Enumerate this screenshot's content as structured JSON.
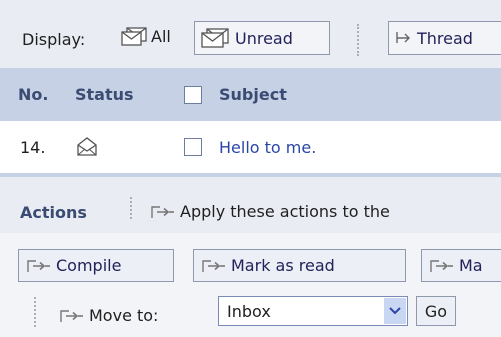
{
  "display": {
    "label": "Display:",
    "all_label": "All",
    "unread_label": "Unread",
    "thread_label": "Thread"
  },
  "table": {
    "columns": {
      "no": "No.",
      "status": "Status",
      "subject": "Subject"
    },
    "rows": [
      {
        "no": "14.",
        "subject": "Hello to me."
      }
    ]
  },
  "actions": {
    "label": "Actions",
    "description": "Apply these actions to the",
    "buttons": {
      "compile": "Compile",
      "mark_read": "Mark as read",
      "mark_partial": "Ma"
    },
    "move_to_label": "Move to:",
    "folder_selected": "Inbox",
    "go_label": "Go"
  },
  "colors": {
    "bar_bg": "#e9ecf3",
    "header_bg": "#c7d1e6",
    "link": "#2a46a8",
    "header_text": "#3a4c72"
  }
}
